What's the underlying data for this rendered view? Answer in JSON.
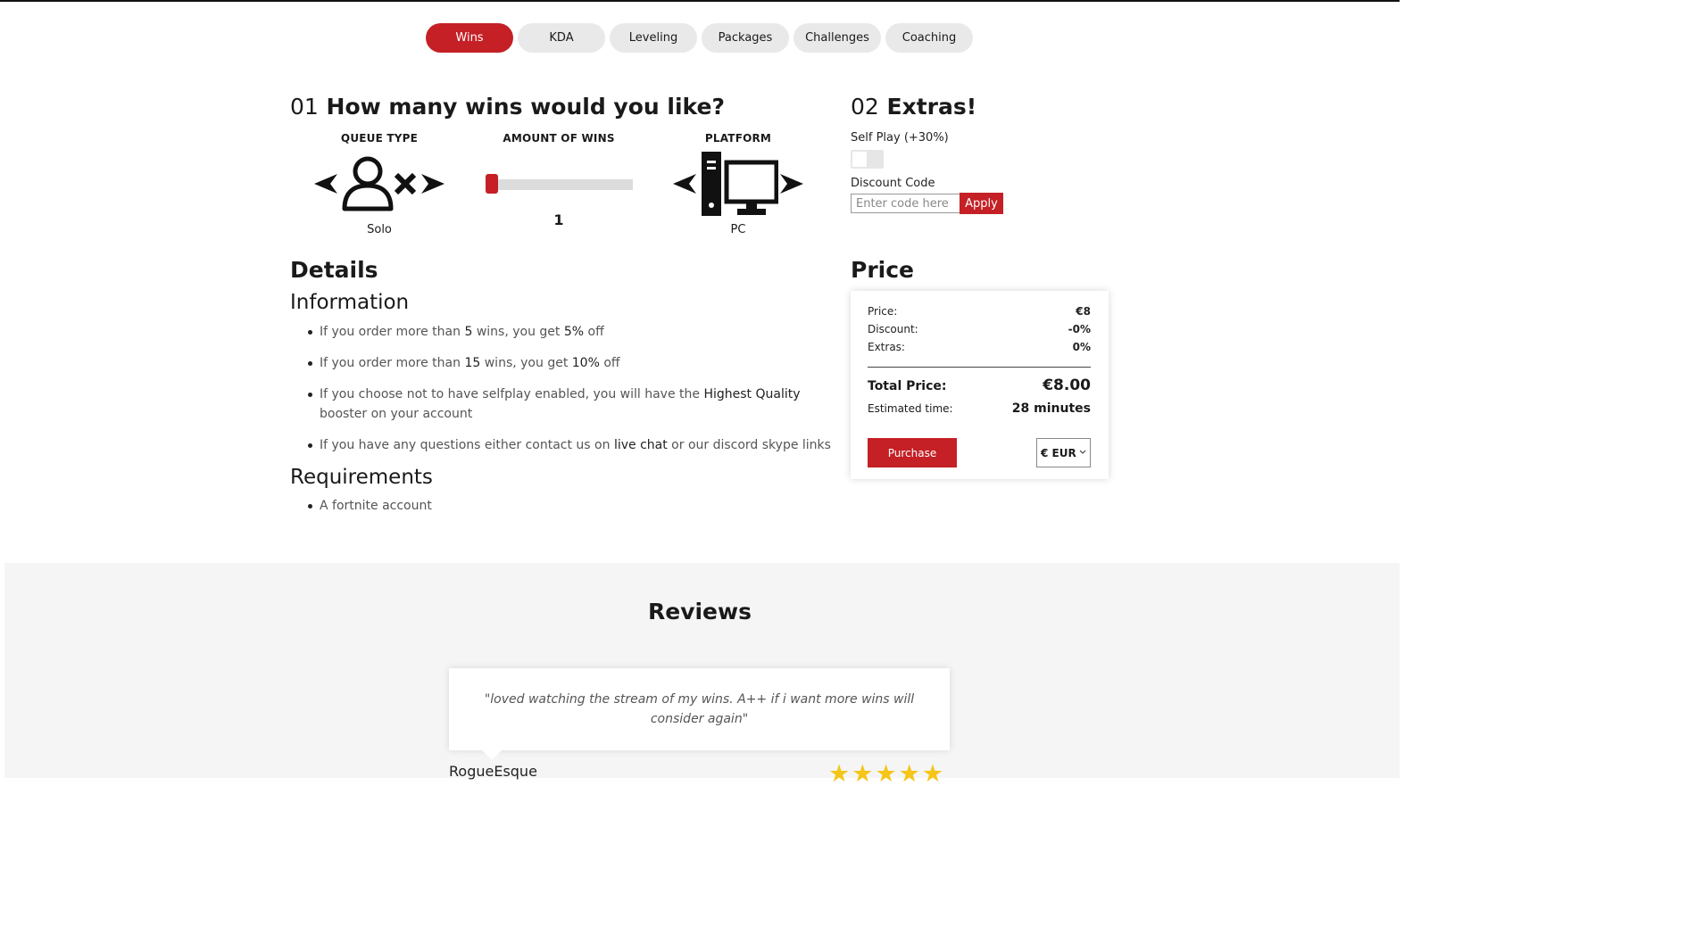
{
  "tabs": [
    {
      "label": "Wins",
      "active": true
    },
    {
      "label": "KDA",
      "active": false
    },
    {
      "label": "Leveling",
      "active": false
    },
    {
      "label": "Packages",
      "active": false
    },
    {
      "label": "Challenges",
      "active": false
    },
    {
      "label": "Coaching",
      "active": false
    }
  ],
  "step1": {
    "number": "01",
    "title": "How many wins would you like?",
    "queue_type": {
      "label": "QUEUE TYPE",
      "value": "Solo",
      "icon": "solo-player-icon"
    },
    "amount": {
      "label": "AMOUNT OF WINS",
      "value": "1",
      "fraction": 0.0
    },
    "platform": {
      "label": "PLATFORM",
      "value": "PC",
      "icon": "pc-icon"
    }
  },
  "step2": {
    "number": "02",
    "title": "Extras!",
    "self_play_label": "Self Play (+30%)",
    "self_play_enabled": false,
    "discount_label": "Discount Code",
    "discount_placeholder": "Enter code here",
    "apply_label": "Apply"
  },
  "details": {
    "title": "Details",
    "information_title": "Information",
    "info": [
      {
        "a": "If you order more than ",
        "b": "5",
        "c": " wins, you get ",
        "d": "5%",
        "e": " off"
      },
      {
        "a": "If you order more than ",
        "b": "15",
        "c": " wins, you get ",
        "d": "10%",
        "e": " off"
      },
      {
        "a": "If you choose not to have selfplay enabled, you will have the ",
        "b": "Highest Quality",
        "c": " booster on your account"
      },
      {
        "a": "If you have any questions either contact us on ",
        "b": "live chat",
        "c": " or our discord skype links"
      }
    ],
    "requirements_title": "Requirements",
    "requirements": [
      "A fortnite account"
    ]
  },
  "price": {
    "title": "Price",
    "price_label": "Price:",
    "price_value": "€8",
    "discount_label": "Discount:",
    "discount_value": "-0%",
    "extras_label": "Extras:",
    "extras_value": "0%",
    "total_label": "Total Price:",
    "total_value": "€8.00",
    "time_label": "Estimated time:",
    "time_value": "28 minutes",
    "purchase_label": "Purchase",
    "currency": "€ EUR"
  },
  "reviews": {
    "title": "Reviews",
    "items": [
      {
        "text": "\"loved watching the stream of my wins. A++ if i want more wins will consider again\"",
        "author": "RogueEsque",
        "stars": 5
      }
    ]
  },
  "colors": {
    "accent": "#c42026",
    "tab_bg": "#e9e9e9",
    "star": "#f5c518"
  }
}
